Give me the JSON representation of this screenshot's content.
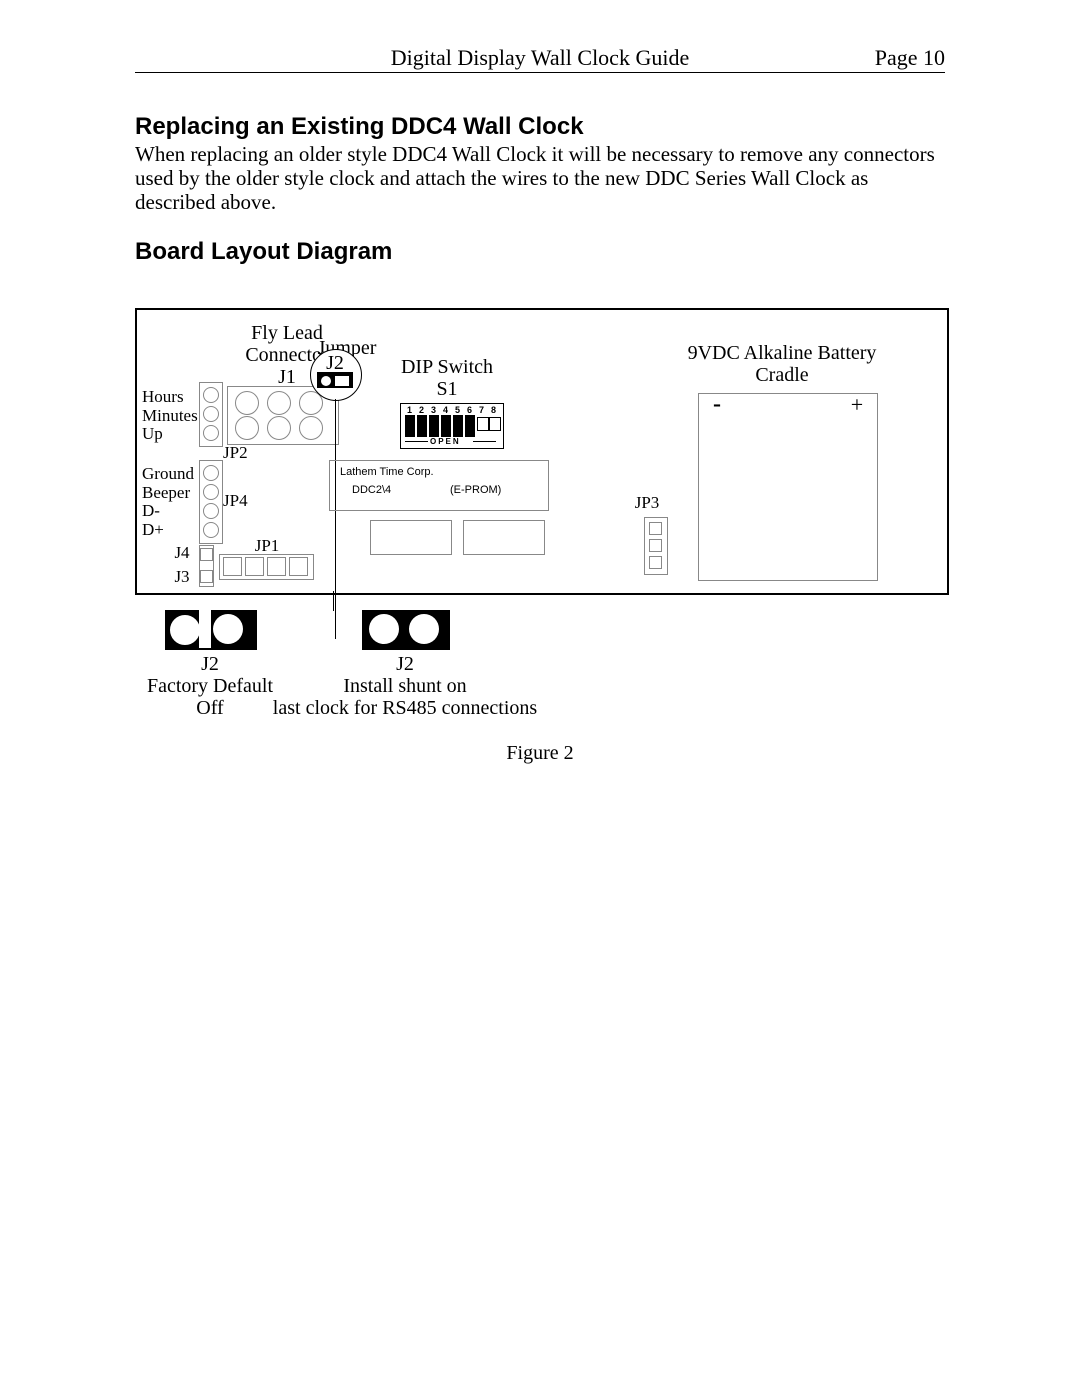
{
  "header": {
    "title": "Digital Display Wall Clock Guide",
    "page": "Page 10"
  },
  "section1": {
    "heading": "Replacing an Existing DDC4 Wall Clock",
    "body": "When replacing an older style DDC4 Wall Clock it will be necessary to remove any connectors used by the older style clock and attach the wires to the new DDC Series Wall Clock as described above."
  },
  "section2": {
    "heading": "Board Layout Diagram"
  },
  "diagram": {
    "flylead": "Fly Lead\nConnector\nJ1",
    "jumper": "Jumper",
    "j2": "J2",
    "dip": "DIP Switch\nS1",
    "battery": "9VDC Alkaline Battery\nCradle",
    "minus": "-",
    "plus": "+",
    "pins_left": "Hours\nMinutes\nUp",
    "pins_left2": "Ground\nBeeper\nD-\nD+",
    "jp2": "JP2",
    "jp4": "JP4",
    "jp1": "JP1",
    "jp3": "JP3",
    "j4": "J4",
    "j3": "J3",
    "eprom_vendor": "Lathem Time Corp.",
    "eprom_model": "DDC2\\4",
    "eprom_type": "(E-PROM)",
    "dip_nums": [
      "1",
      "2",
      "3",
      "4",
      "5",
      "6",
      "7",
      "8"
    ],
    "dip_open": "OPEN"
  },
  "j2a": {
    "title": "J2",
    "l1": "Factory Default",
    "l2": "Off"
  },
  "j2b": {
    "title": "J2",
    "l1": "Install shunt on",
    "l2": "last clock for RS485 connections"
  },
  "figure": "Figure 2"
}
